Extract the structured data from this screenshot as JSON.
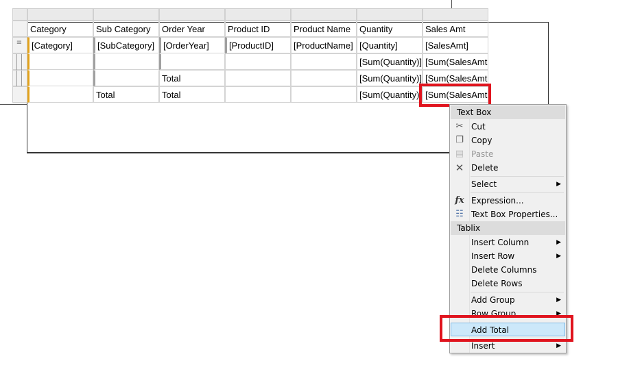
{
  "tablix": {
    "columns": [
      "Category",
      "Sub Category",
      "Order Year",
      "Product ID",
      "Product Name",
      "Quantity",
      "Sales Amt"
    ],
    "rows": [
      [
        "[Category]",
        "[SubCategory]",
        "[OrderYear]",
        "[ProductID]",
        "[ProductName]",
        "[Quantity]",
        "[SalesAmt]"
      ],
      [
        "",
        "",
        "",
        "",
        "",
        "[Sum(Quantity)]",
        "[Sum(SalesAmt"
      ],
      [
        "",
        "",
        "Total",
        "",
        "",
        "[Sum(Quantity)]",
        "[Sum(SalesAmt"
      ],
      [
        "",
        "Total",
        "Total",
        "",
        "",
        "[Sum(Quantity)]",
        "[Sum(SalesAmt"
      ]
    ]
  },
  "menu": {
    "header_textbox": "Text Box",
    "cut": "Cut",
    "copy": "Copy",
    "paste": "Paste",
    "delete": "Delete",
    "select": "Select",
    "expression": "Expression...",
    "textbox_properties": "Text Box Properties...",
    "header_tablix": "Tablix",
    "insert_column": "Insert Column",
    "insert_row": "Insert Row",
    "delete_columns": "Delete Columns",
    "delete_rows": "Delete Rows",
    "add_group": "Add Group",
    "row_group": "Row Group",
    "add_total": "Add Total",
    "insert": "Insert"
  },
  "icons": {
    "cut": "scissors-icon",
    "copy": "copy-icon",
    "paste": "paste-icon",
    "delete": "x-icon",
    "expression": "fx-icon",
    "properties": "properties-icon"
  },
  "colors": {
    "highlight": "#e0141e",
    "category_group": "#e3a21a",
    "hover": "#cce8fa"
  }
}
